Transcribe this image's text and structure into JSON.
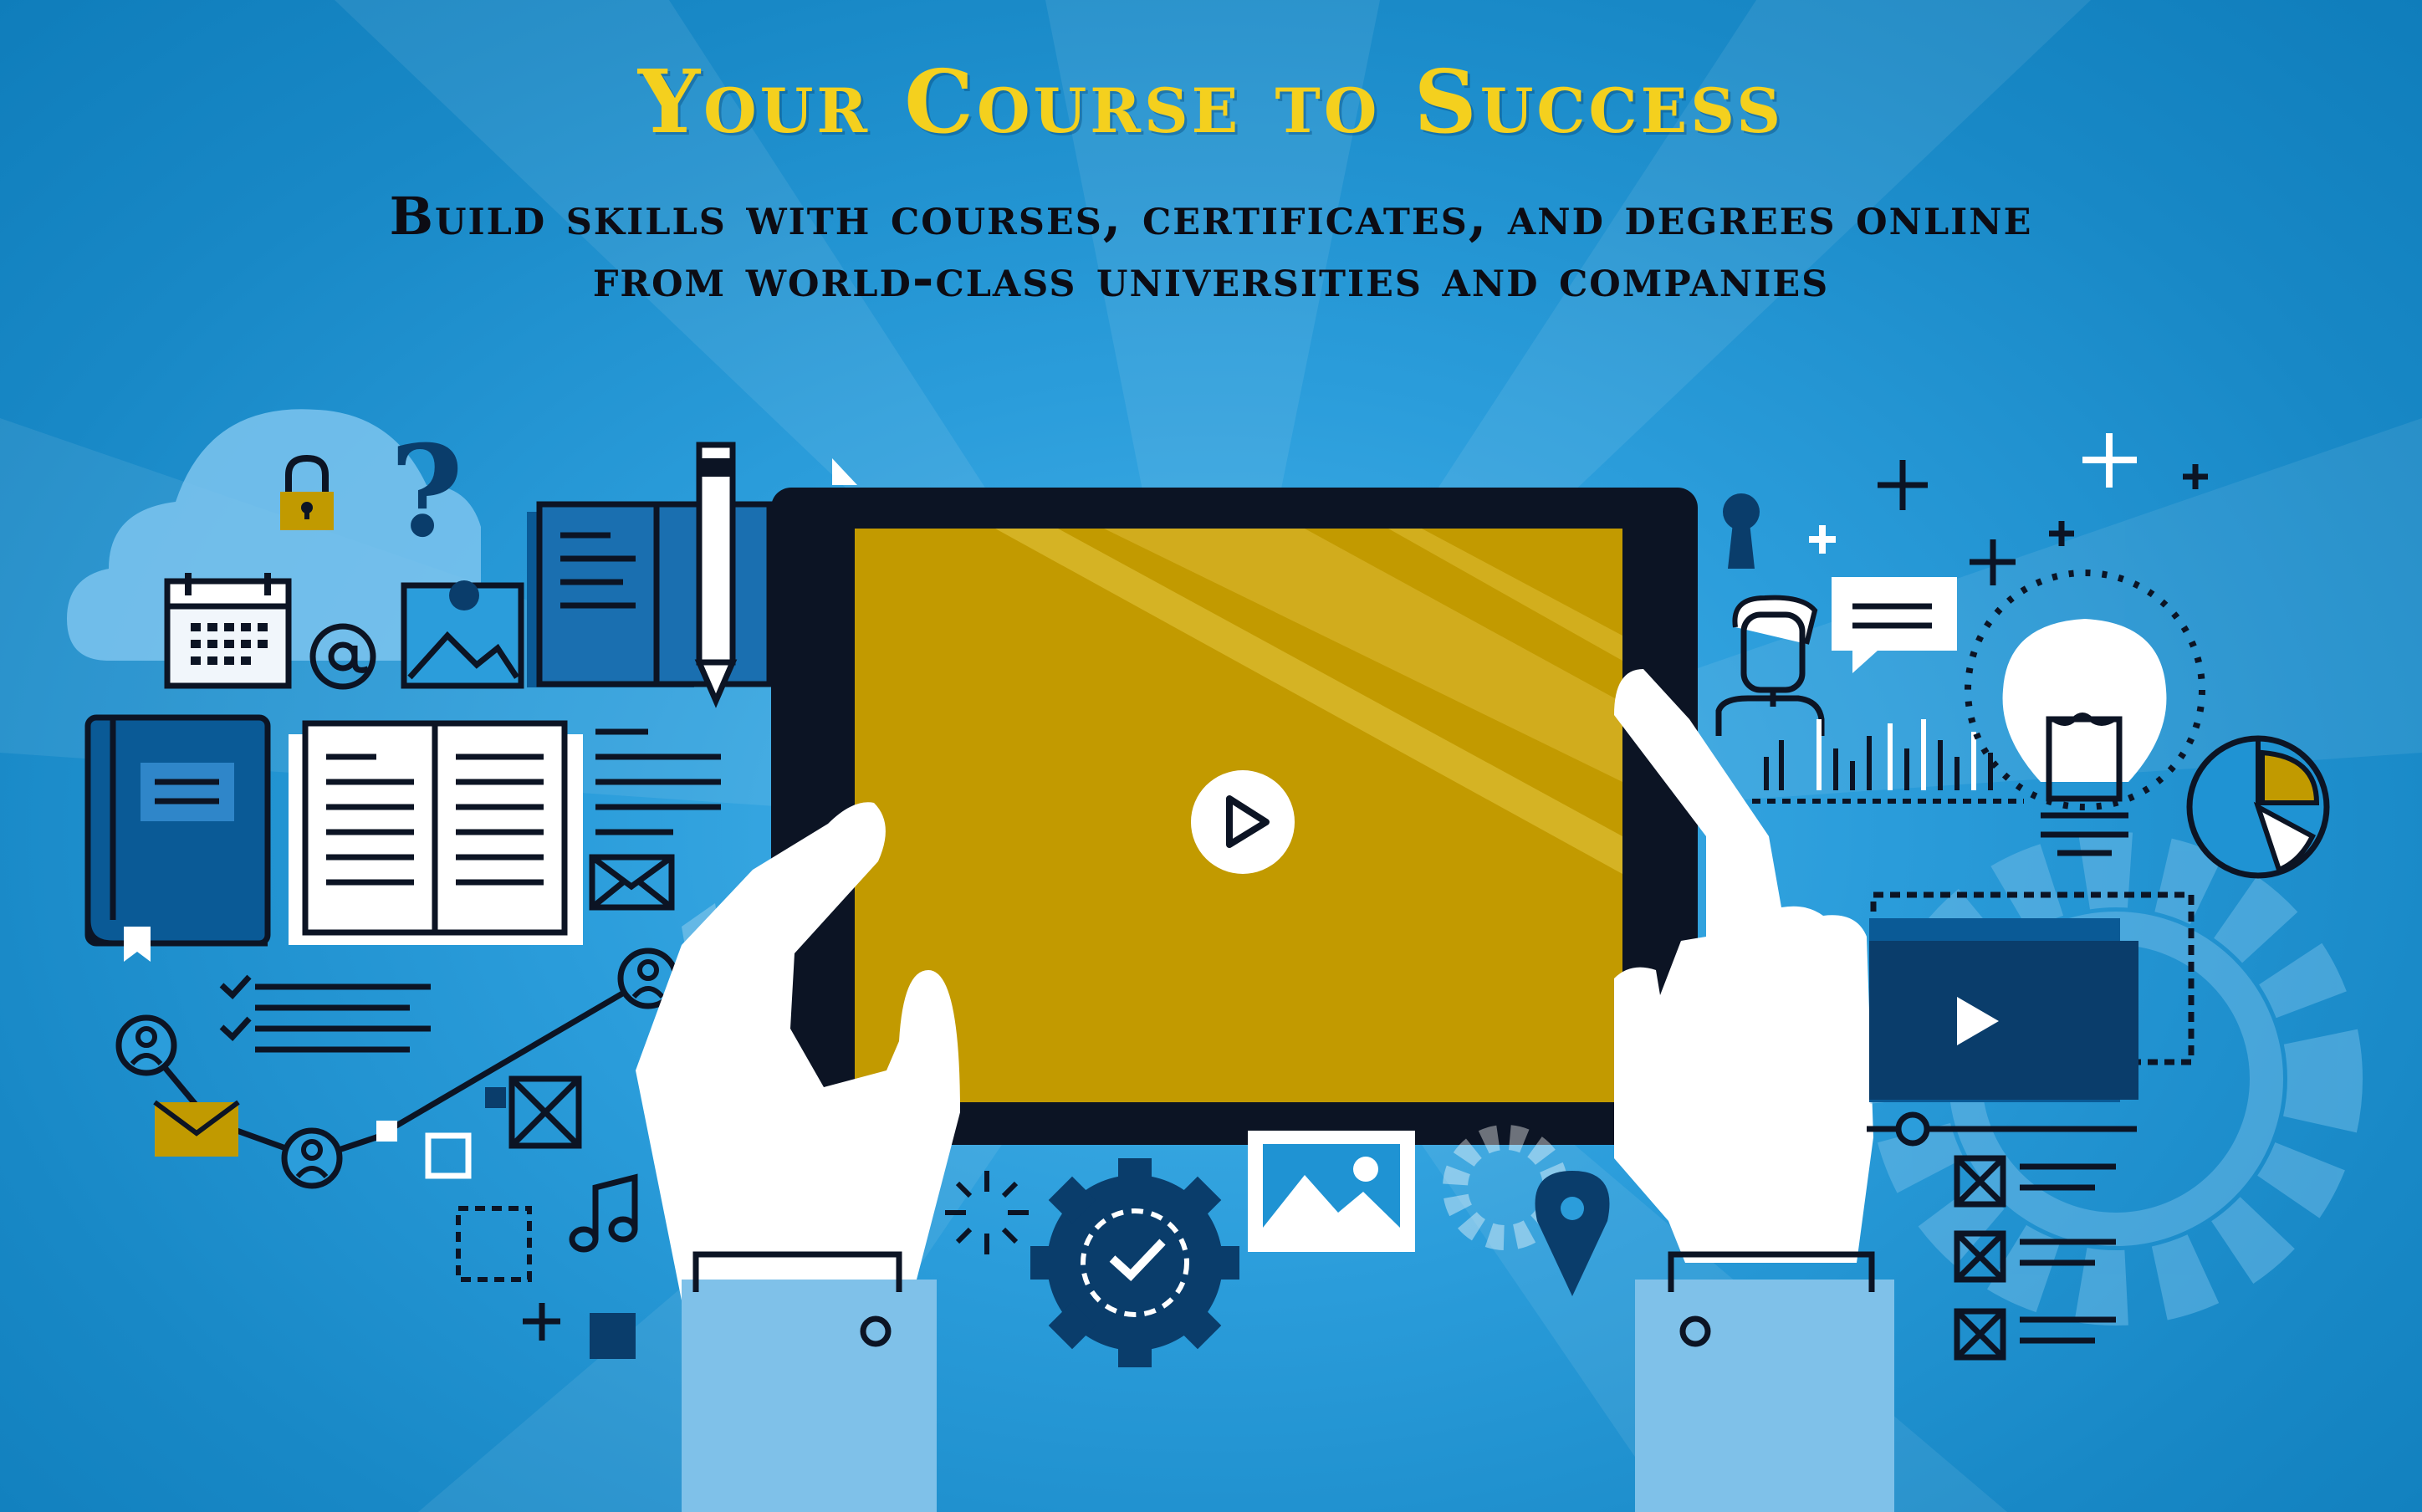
{
  "banner": {
    "title": "Your Course to Success",
    "subtitle_line1": "Build skills with courses, certificates, and degrees online",
    "subtitle_line2": "from world-class universities and companies"
  },
  "illustration": {
    "colors": {
      "background": "#1f93d3",
      "accent_gold": "#c19a00",
      "title_yellow": "#f4d01e",
      "navy": "#0a3d6b",
      "outline": "#0c1424",
      "white": "#ffffff"
    },
    "icons": [
      "cloud-icon",
      "padlock-icon",
      "question-mark-icon",
      "calendar-icon",
      "at-sign-icon",
      "image-icon",
      "notebook-icon",
      "pen-icon",
      "book-icon",
      "open-book-icon",
      "text-lines-icon",
      "envelope-icon",
      "checklist-icon",
      "user-network-icon",
      "play-icon",
      "keyhole-icon",
      "person-icon",
      "chat-bubble-icon",
      "lightbulb-icon",
      "pie-chart-icon",
      "bar-chart-icon",
      "video-player-icon",
      "gear-icon",
      "map-pin-icon",
      "music-note-icon",
      "checkbox-list-icon",
      "plus-icon"
    ]
  }
}
